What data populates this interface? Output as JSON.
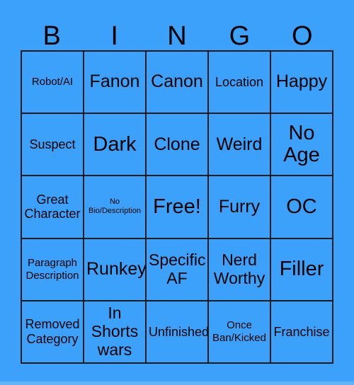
{
  "card": {
    "background_color": "#3ba1fb",
    "border_color": "#1b1b1b",
    "text_color": "#000000",
    "header": {
      "letters": [
        "B",
        "I",
        "N",
        "G",
        "O"
      ]
    },
    "rows": [
      [
        {
          "label": "Robot/AI",
          "size": "sm"
        },
        {
          "label": "Fanon",
          "size": "xl"
        },
        {
          "label": "Canon",
          "size": "xl"
        },
        {
          "label": "Location",
          "size": "md"
        },
        {
          "label": "Happy",
          "size": "xl"
        }
      ],
      [
        {
          "label": "Suspect",
          "size": "md"
        },
        {
          "label": "Dark",
          "size": "xxl"
        },
        {
          "label": "Clone",
          "size": "xl"
        },
        {
          "label": "Weird",
          "size": "xl"
        },
        {
          "label": "No\nAge",
          "size": "xxl"
        }
      ],
      [
        {
          "label": "Great\nCharacter",
          "size": "md"
        },
        {
          "label": "No\nBio/Description",
          "size": "xs"
        },
        {
          "label": "Free!",
          "size": "xxl"
        },
        {
          "label": "Furry",
          "size": "xl"
        },
        {
          "label": "OC",
          "size": "xxl"
        }
      ],
      [
        {
          "label": "Paragraph\nDescription",
          "size": "sm"
        },
        {
          "label": "Runkey",
          "size": "xl"
        },
        {
          "label": "Specific\nAF",
          "size": "lg"
        },
        {
          "label": "Nerd\nWorthy",
          "size": "lg"
        },
        {
          "label": "Filler",
          "size": "xxl"
        }
      ],
      [
        {
          "label": "Removed\nCategory",
          "size": "md"
        },
        {
          "label": "In\nShorts\nwars",
          "size": "lg"
        },
        {
          "label": "Unfinished",
          "size": "md"
        },
        {
          "label": "Once\nBan/Kicked",
          "size": "sm"
        },
        {
          "label": "Franchise",
          "size": "md"
        }
      ]
    ]
  }
}
